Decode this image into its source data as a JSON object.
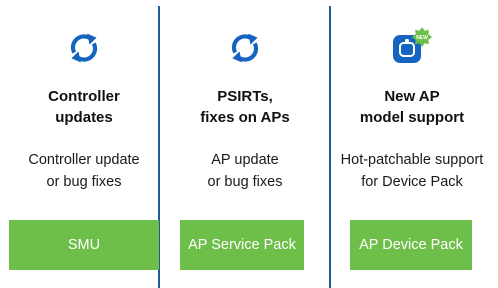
{
  "colors": {
    "divider": "#1f5b9c",
    "icon_blue": "#1565c0",
    "button_green": "#6ebe4a",
    "badge_green": "#6ebe4a"
  },
  "columns": [
    {
      "icon": "refresh-icon",
      "heading_line1": "Controller",
      "heading_line2": "updates",
      "desc_line1": "Controller update",
      "desc_line2": "or bug fixes",
      "button_label": "SMU"
    },
    {
      "icon": "refresh-icon",
      "heading_line1": "PSIRTs,",
      "heading_line2": "fixes on APs",
      "desc_line1": "AP update",
      "desc_line2": "or bug fixes",
      "button_label": "AP Service Pack"
    },
    {
      "icon": "new-device-icon",
      "badge_text": "NEW",
      "heading_line1": "New AP",
      "heading_line2": "model support",
      "desc_line1": "Hot-patchable support",
      "desc_line2": "for Device Pack",
      "button_label": "AP Device Pack"
    }
  ]
}
